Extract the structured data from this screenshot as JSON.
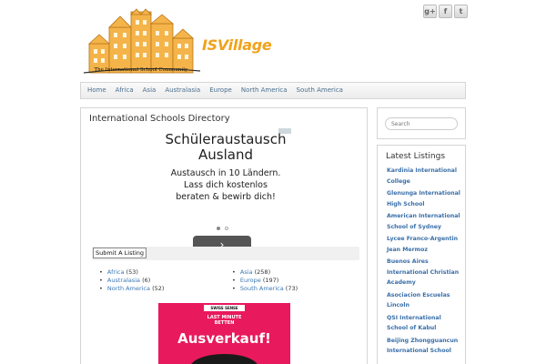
{
  "header": {
    "site_name": "ISVillage",
    "tagline": "The International School Community",
    "social": [
      {
        "label": "g+",
        "icon": "google-plus-icon"
      },
      {
        "label": "f",
        "icon": "facebook-icon"
      },
      {
        "label": "t",
        "icon": "twitter-icon"
      }
    ]
  },
  "nav": {
    "items": [
      "Home",
      "Africa",
      "Asia",
      "Australasia",
      "Europe",
      "North America",
      "South America"
    ]
  },
  "main": {
    "title": "International Schools Directory",
    "ad1": {
      "headline_1": "Schüleraustausch",
      "headline_2": "Ausland",
      "body_1": "Austausch in 10 Ländern.",
      "body_2": "Lass dich kostenlos",
      "body_3": "beraten & bewirb dich!",
      "button": "›"
    },
    "submit_label": "Submit A Listing",
    "regions": [
      {
        "name": "Africa",
        "count": "(53)"
      },
      {
        "name": "Asia",
        "count": "(258)"
      },
      {
        "name": "Australasia",
        "count": "(6)"
      },
      {
        "name": "Europe",
        "count": "(197)"
      },
      {
        "name": "North America",
        "count": "(52)"
      },
      {
        "name": "South America",
        "count": "(73)"
      }
    ],
    "ad2": {
      "brand": "SWISS SENSE",
      "line_1": "LAST MINUTE",
      "line_2": "BETTEN",
      "headline": "Ausverkauf!"
    }
  },
  "sidebar": {
    "search_placeholder": "Search",
    "latest_title": "Latest Listings",
    "listings": [
      "Kardinia International College",
      "Glenunga International High School",
      "American International School of Sydney",
      "Lycee Franco-Argentin Jean Mermoz",
      "Buenos Aires International Christian Academy",
      "Asociacion Escuelas Lincoln",
      "QSI International School of Kabul",
      "Beijing Zhongguancun International School"
    ]
  },
  "colors": {
    "logo_orange": "#f0a21a",
    "link_blue": "#3a78b5",
    "ad_pink": "#e8195c"
  }
}
